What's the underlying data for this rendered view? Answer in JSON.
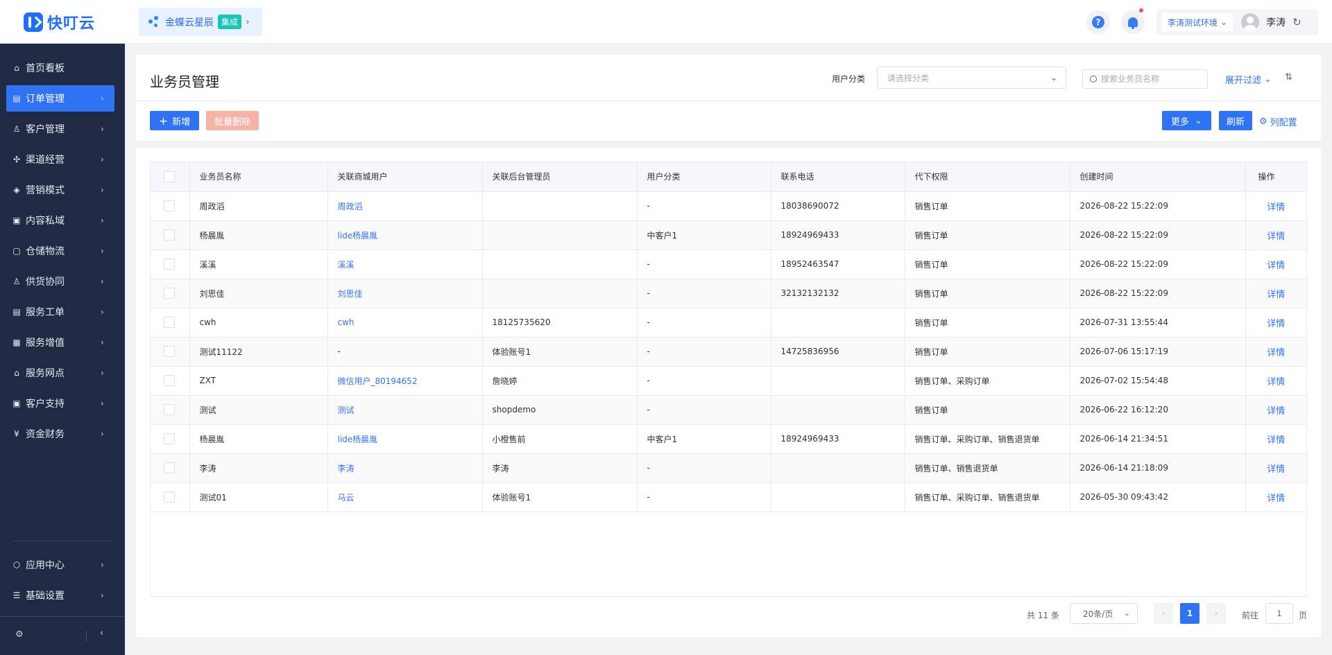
{
  "app": {
    "logo_text": "快叮云"
  },
  "integration": {
    "name": "金蝶云星辰",
    "tag": "集成"
  },
  "topbar": {
    "help": "?",
    "env_label": "李涛测试环境",
    "user_name": "李涛"
  },
  "sidebar": {
    "items": [
      {
        "label": "首页看板",
        "icon": "home-icon",
        "glyph": "⌂"
      },
      {
        "label": "订单管理",
        "icon": "order-icon",
        "glyph": "▤"
      },
      {
        "label": "客户管理",
        "icon": "customer-icon",
        "glyph": "♙"
      },
      {
        "label": "渠道经营",
        "icon": "channel-icon",
        "glyph": "✣"
      },
      {
        "label": "营销模式",
        "icon": "tag-icon",
        "glyph": "◈"
      },
      {
        "label": "内容私域",
        "icon": "image-icon",
        "glyph": "▣"
      },
      {
        "label": "仓储物流",
        "icon": "warehouse-icon",
        "glyph": "▢"
      },
      {
        "label": "供货协同",
        "icon": "supply-icon",
        "glyph": "♙"
      },
      {
        "label": "服务工单",
        "icon": "ticket-icon",
        "glyph": "▤"
      },
      {
        "label": "服务增值",
        "icon": "bag-icon",
        "glyph": "▦"
      },
      {
        "label": "服务网点",
        "icon": "store-icon",
        "glyph": "⌂"
      },
      {
        "label": "客户支持",
        "icon": "support-icon",
        "glyph": "▣"
      },
      {
        "label": "资金财务",
        "icon": "yen-icon",
        "glyph": "¥"
      }
    ],
    "bottom_items": [
      {
        "label": "应用中心",
        "icon": "app-center-icon",
        "glyph": "⬡"
      },
      {
        "label": "基础设置",
        "icon": "settings-list-icon",
        "glyph": "☰"
      }
    ],
    "active_index": 1
  },
  "page": {
    "title": "业务员管理",
    "filter_label": "用户分类",
    "filter_placeholder": "请选择分类",
    "search_placeholder": "搜索业务员名称",
    "expand_filter": "展开过滤",
    "add_button": "新增",
    "batch_delete_button": "批量删除",
    "more_button": "更多",
    "refresh_button": "刷新",
    "column_config": "列配置"
  },
  "table": {
    "columns": [
      "业务员名称",
      "关联商城用户",
      "关联后台管理员",
      "用户分类",
      "联系电话",
      "代下权限",
      "创建时间",
      "操作"
    ],
    "action_label": "详情",
    "rows": [
      [
        "周政滔",
        "周政滔",
        "",
        "-",
        "18038690072",
        "销售订单",
        "2026-08-22 15:22:09"
      ],
      [
        "杨晨胤",
        "lide杨晨胤",
        "",
        "中客户1",
        "18924969433",
        "销售订单",
        "2026-08-22 15:22:09"
      ],
      [
        "溪溪",
        "溪溪",
        "",
        "-",
        "18952463547",
        "销售订单",
        "2026-08-22 15:22:09"
      ],
      [
        "刘思佳",
        "刘思佳",
        "",
        "-",
        "32132132132",
        "销售订单",
        "2026-08-22 15:22:09"
      ],
      [
        "cwh",
        "cwh",
        "18125735620",
        "-",
        "",
        "销售订单",
        "2026-07-31 13:55:44"
      ],
      [
        "测试11122",
        "-",
        "体验账号1",
        "-",
        "14725836956",
        "销售订单",
        "2026-07-06 15:17:19"
      ],
      [
        "ZXT",
        "微信用户_80194652",
        "詹晓婷",
        "-",
        "",
        "销售订单、采购订单",
        "2026-07-02 15:54:48"
      ],
      [
        "测试",
        "测试",
        "shopdemo",
        "-",
        "",
        "销售订单",
        "2026-06-22 16:12:20"
      ],
      [
        "杨晨胤",
        "lide杨晨胤",
        "小橙售前",
        "中客户1",
        "18924969433",
        "销售订单、采购订单、销售退货单",
        "2026-06-14 21:34:51"
      ],
      [
        "李涛",
        "李涛",
        "李涛",
        "-",
        "",
        "销售订单、销售退货单",
        "2026-06-14 21:18:09"
      ],
      [
        "测试01",
        "马云",
        "体验账号1",
        "-",
        "",
        "销售订单、采购订单、销售退货单",
        "2026-05-30 09:43:42"
      ]
    ]
  },
  "pagination": {
    "total": "共 11 条",
    "page_size": "20条/页",
    "current_page": "1",
    "goto_label": "前往",
    "goto_value": "1",
    "page_unit": "页"
  },
  "colors": {
    "primary": "#2f73f5",
    "sidebar_bg": "#202a44",
    "danger_light": "#f7b3a5"
  }
}
